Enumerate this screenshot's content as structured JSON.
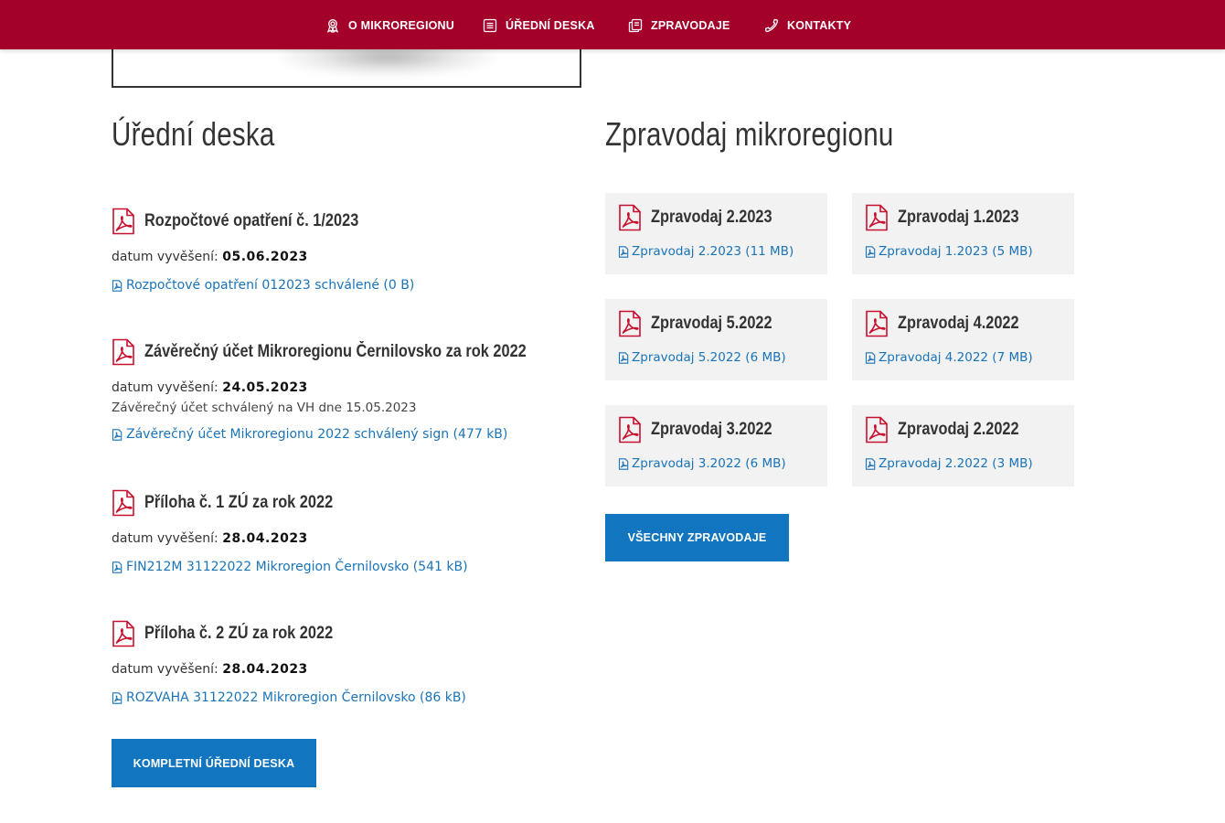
{
  "nav": {
    "items": [
      {
        "label": "O mikroregionu",
        "icon": "award-icon"
      },
      {
        "label": "Úřední deska",
        "icon": "document-list-icon"
      },
      {
        "label": "Zpravodaje",
        "icon": "copy-document-icon"
      },
      {
        "label": "Kontakty",
        "icon": "phone-icon"
      }
    ]
  },
  "board": {
    "title": "Úřední deska",
    "date_label": "datum vyvěšení:",
    "items": [
      {
        "title": "Rozpočtové opatření č. 1/2023",
        "date": "05.06.2023",
        "note": "",
        "file": "Rozpočtové opatření 012023 schválené (0 B)"
      },
      {
        "title": "Závěrečný účet Mikroregionu Černilovsko za rok 2022",
        "date": "24.05.2023",
        "note": "Závěrečný účet schválený na VH dne 15.05.2023",
        "file": "Závěrečný účet Mikroregionu 2022 schválený sign (477 kB)"
      },
      {
        "title": "Příloha č. 1 ZÚ za rok 2022",
        "date": "28.04.2023",
        "note": "",
        "file": "FIN212M 31122022 Mikroregion Černilovsko (541 kB)"
      },
      {
        "title": "Příloha č. 2 ZÚ za rok 2022",
        "date": "28.04.2023",
        "note": "",
        "file": "ROZVAHA 31122022 Mikroregion Černilovsko (86 kB)"
      }
    ],
    "button_label": "Kompletní úřední deska"
  },
  "newsletter": {
    "title": "Zpravodaj mikroregionu",
    "cards": [
      {
        "title": "Zpravodaj 2.2023",
        "link": "Zpravodaj 2.2023 (11 MB)"
      },
      {
        "title": "Zpravodaj 1.2023",
        "link": "Zpravodaj 1.2023 (5 MB)"
      },
      {
        "title": "Zpravodaj 5.2022",
        "link": "Zpravodaj 5.2022 (6 MB)"
      },
      {
        "title": "Zpravodaj 4.2022",
        "link": "Zpravodaj 4.2022 (7 MB)"
      },
      {
        "title": "Zpravodaj 3.2022",
        "link": "Zpravodaj 3.2022 (6 MB)"
      },
      {
        "title": "Zpravodaj 2.2022",
        "link": "Zpravodaj 2.2022 (3 MB)"
      }
    ],
    "button_label": "Všechny zpravodaje"
  },
  "colors": {
    "nav_bg": "#a4012a",
    "link": "#1a74b8",
    "button": "#1176bf",
    "pdf_icon": "#c8102e",
    "card_bg": "#f2f2f2"
  }
}
